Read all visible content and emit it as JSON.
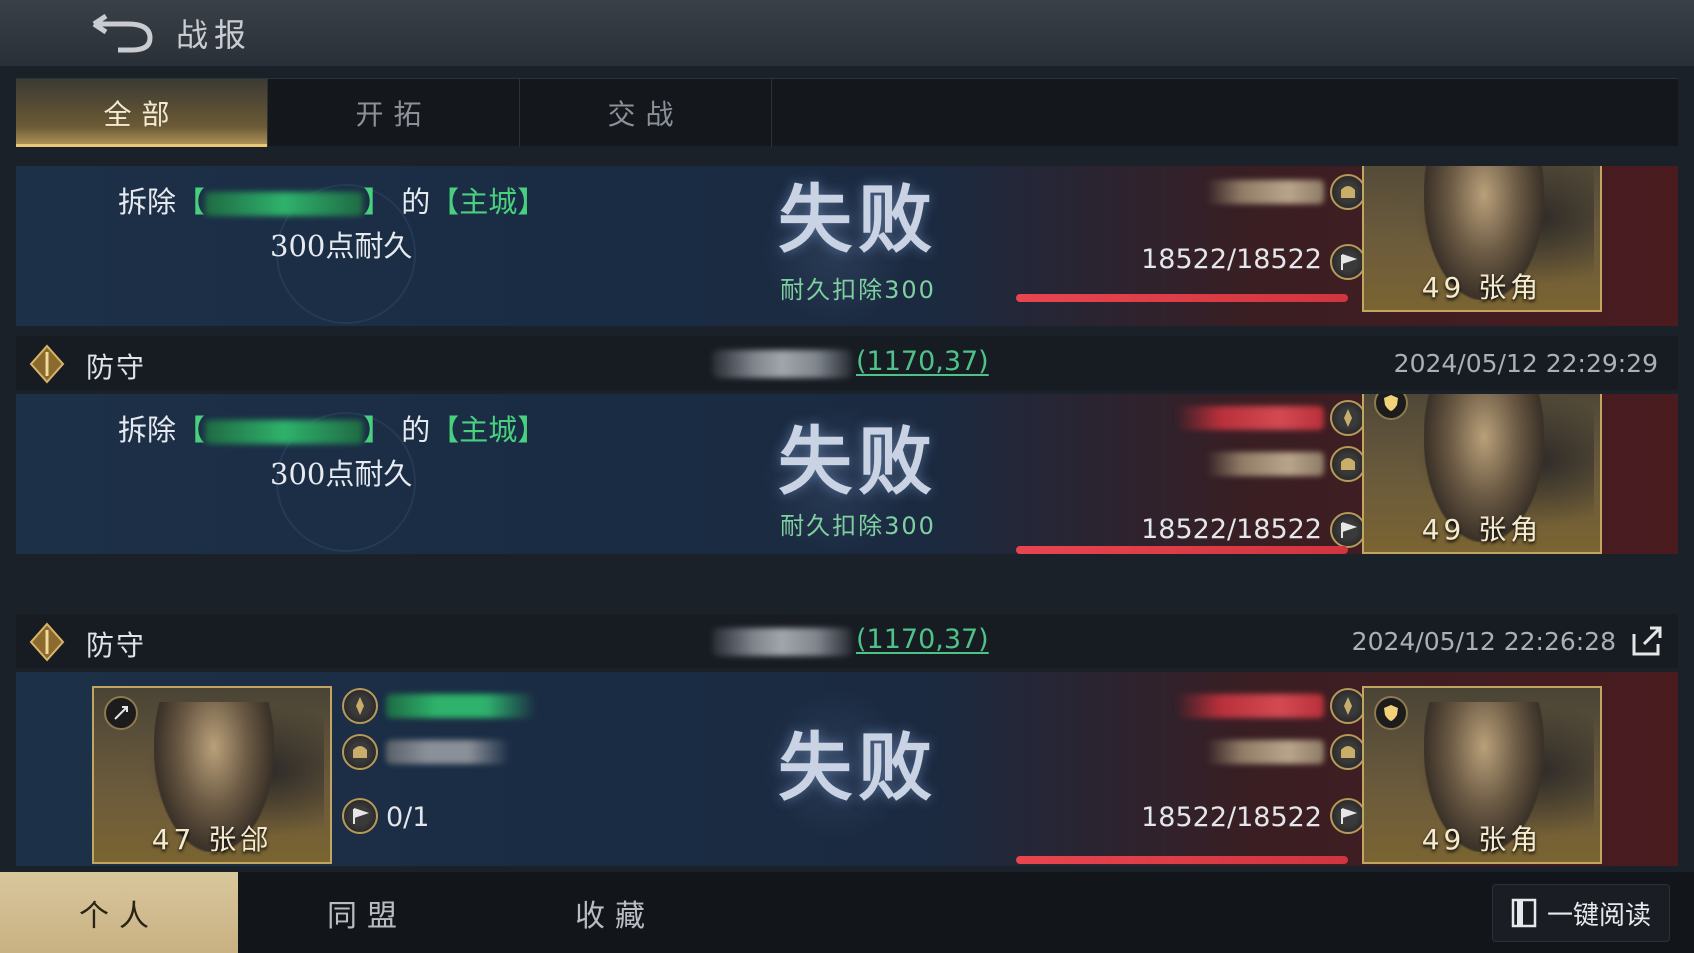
{
  "title": "战报",
  "tabs": [
    "全部",
    "开拓",
    "交战"
  ],
  "bottom_tabs": [
    "个人",
    "同盟",
    "收藏"
  ],
  "read_all_label": "一键阅读",
  "reports": [
    {
      "desc_prefix": "拆除",
      "desc_of": "的",
      "desc_target": "【主城】",
      "desc_line2": "300点耐久",
      "result": "失败",
      "result_sub": "耐久扣除300",
      "troops": "18522/18522",
      "enemy_general": "49 张角"
    },
    {
      "type": "防守",
      "coords": "(1170,37)",
      "time": "2024/05/12 22:29:29",
      "desc_prefix": "拆除",
      "desc_of": "的",
      "desc_target": "【主城】",
      "desc_line2": "300点耐久",
      "result": "失败",
      "result_sub": "耐久扣除300",
      "troops": "18522/18522",
      "enemy_general": "49 张角"
    },
    {
      "type": "防守",
      "coords": "(1170,37)",
      "time": "2024/05/12 22:26:28",
      "own_general": "47 张郃",
      "own_troops": "0/1",
      "result": "失败",
      "troops": "18522/18522",
      "enemy_general": "49 张角"
    }
  ],
  "colors": {
    "gold": "#c2a560",
    "green": "#48d07f",
    "red": "#e8454f"
  },
  "icons": [
    "back-arrow-icon",
    "shield-icon",
    "share-icon",
    "helmet-icon",
    "flag-icon",
    "spear-icon",
    "book-icon"
  ]
}
